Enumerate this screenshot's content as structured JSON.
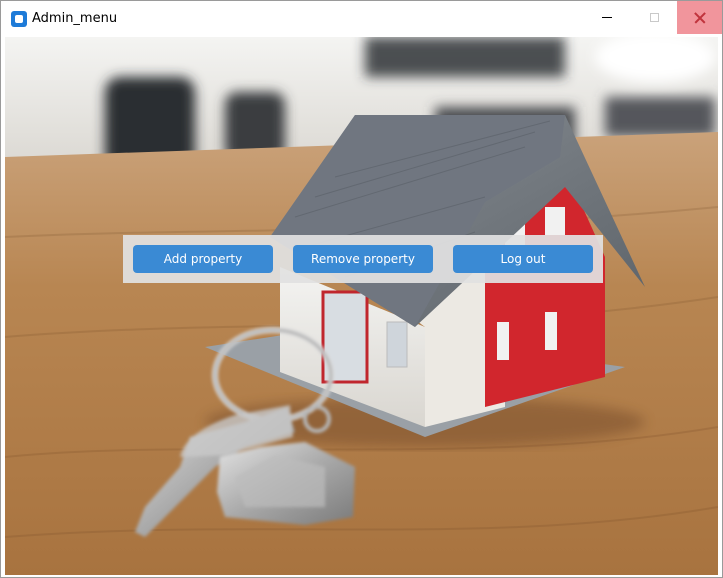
{
  "window": {
    "title": "Admin_menu",
    "icon": "app-icon",
    "controls": [
      "minimize-icon",
      "maximize-icon",
      "close-icon"
    ]
  },
  "background": {
    "description_icon": "house-with-keys-photo"
  },
  "menu": {
    "add_label": "Add property",
    "remove_label": "Remove property",
    "logout_label": "Log out"
  },
  "colors": {
    "button": "#3a8ad4",
    "button_text": "#ffffff",
    "panel": "#e1e1e1",
    "close_hover": "#f1959c"
  }
}
